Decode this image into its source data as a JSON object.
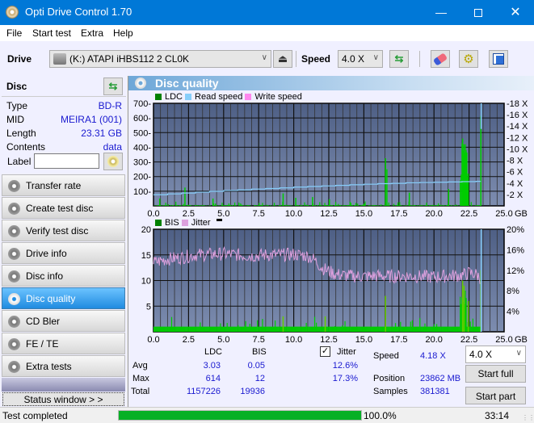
{
  "window": {
    "title": "Opti Drive Control 1.70",
    "minimize_icon": "minimize-icon",
    "maximize_icon": "maximize-icon",
    "close_icon": "close-icon"
  },
  "menu": {
    "items": [
      {
        "label": "File",
        "accel": "F"
      },
      {
        "label": "Start test",
        "accel": "S"
      },
      {
        "label": "Extra",
        "accel": "x"
      },
      {
        "label": "Help",
        "accel": "H"
      }
    ]
  },
  "toolbar": {
    "drive_label": "Drive",
    "drive_value": "(K:)  ATAPI iHBS112  2 CL0K",
    "speed_label": "Speed",
    "speed_value": "4.0 X",
    "icons": [
      "drive-icon",
      "eject-icon",
      "refresh-icon",
      "eraser-icon",
      "settings-icon",
      "save-icon"
    ]
  },
  "disc": {
    "header": "Disc",
    "rows": [
      {
        "key": "Type",
        "value": "BD-R"
      },
      {
        "key": "MID",
        "value": "MEIRA1 (001)"
      },
      {
        "key": "Length",
        "value": "23.31 GB"
      },
      {
        "key": "Contents",
        "value": "data"
      }
    ],
    "label_key": "Label",
    "label_value": ""
  },
  "nav": {
    "items": [
      {
        "label": "Transfer rate",
        "active": false
      },
      {
        "label": "Create test disc",
        "active": false
      },
      {
        "label": "Verify test disc",
        "active": false
      },
      {
        "label": "Drive info",
        "active": false
      },
      {
        "label": "Disc info",
        "active": false
      },
      {
        "label": "Disc quality",
        "active": true
      },
      {
        "label": "CD Bler",
        "active": false
      },
      {
        "label": "FE / TE",
        "active": false
      },
      {
        "label": "Extra tests",
        "active": false
      }
    ],
    "status_window": "Status window > >"
  },
  "panel": {
    "title": "Disc quality"
  },
  "chart_data": [
    {
      "type": "bar",
      "title": "LDC / Read speed",
      "legend": [
        "LDC",
        "Read speed",
        "Write speed"
      ],
      "legend_colors": [
        "#008000",
        "#87cefa",
        "#ff88ee"
      ],
      "legend_placement": "top-left",
      "x_ticks": [
        "0.0",
        "2.5",
        "5.0",
        "7.5",
        "10.0",
        "12.5",
        "15.0",
        "17.5",
        "20.0",
        "22.5",
        "25.0"
      ],
      "x_unit": "GB",
      "xlim": [
        0,
        25
      ],
      "y_ticks": [
        "100",
        "200",
        "300",
        "400",
        "500",
        "600",
        "700"
      ],
      "ylim": [
        0,
        700
      ],
      "y2_ticks": [
        "2 X",
        "4 X",
        "6 X",
        "8 X",
        "10 X",
        "12 X",
        "14 X",
        "16 X",
        "18 X"
      ],
      "y2lim": [
        0,
        18
      ],
      "read_speed": {
        "x": [
          0,
          1,
          2,
          3,
          4,
          5,
          6,
          7,
          8,
          9,
          10,
          11,
          12,
          13,
          14,
          15,
          16,
          17,
          18,
          19,
          20,
          21,
          22,
          23,
          23.31
        ],
        "y": [
          1.95,
          2.1,
          2.25,
          2.4,
          2.55,
          2.7,
          2.8,
          2.95,
          3.05,
          3.15,
          3.3,
          3.4,
          3.5,
          3.6,
          3.7,
          3.8,
          3.9,
          3.95,
          4.05,
          4.1,
          4.15,
          4.2,
          4.25,
          4.3,
          4.35
        ]
      },
      "ldc_peaks": [
        {
          "x": 0.4,
          "y": 50
        },
        {
          "x": 2.2,
          "y": 125
        },
        {
          "x": 4.2,
          "y": 50
        },
        {
          "x": 9.2,
          "y": 85
        },
        {
          "x": 10.1,
          "y": 55
        },
        {
          "x": 11.3,
          "y": 60
        },
        {
          "x": 12.5,
          "y": 45
        },
        {
          "x": 16.5,
          "y": 325
        },
        {
          "x": 16.6,
          "y": 250
        },
        {
          "x": 18.2,
          "y": 90
        },
        {
          "x": 21.0,
          "y": 115
        },
        {
          "x": 22.0,
          "y": 460
        },
        {
          "x": 22.1,
          "y": 420
        },
        {
          "x": 22.4,
          "y": 220
        },
        {
          "x": 23.3,
          "y": 614
        }
      ],
      "grid": true
    },
    {
      "type": "bar",
      "title": "BIS / Jitter",
      "legend": [
        "BIS",
        "Jitter"
      ],
      "legend_colors": [
        "#008000",
        "#dda0dd"
      ],
      "legend_placement": "top-left",
      "x_ticks": [
        "0.0",
        "2.5",
        "5.0",
        "7.5",
        "10.0",
        "12.5",
        "15.0",
        "17.5",
        "20.0",
        "22.5",
        "25.0"
      ],
      "x_unit": "GB",
      "xlim": [
        0,
        25
      ],
      "y_ticks": [
        "5",
        "10",
        "15",
        "20"
      ],
      "ylim": [
        0,
        20
      ],
      "y2_ticks": [
        "4%",
        "8%",
        "12%",
        "16%",
        "20%"
      ],
      "y2lim": [
        0,
        20
      ],
      "jitter": {
        "x": [
          0,
          1,
          2,
          3,
          4,
          5,
          6,
          7,
          8,
          9,
          10,
          11,
          11.5,
          12,
          12.5,
          13,
          14,
          15,
          16,
          17,
          18,
          19,
          20,
          21,
          22,
          22.5,
          23,
          23.31
        ],
        "y": [
          13.5,
          14.2,
          14.5,
          15.0,
          15.1,
          15.2,
          15.0,
          14.8,
          15.0,
          15.0,
          15.1,
          14.8,
          14.0,
          12.5,
          11.8,
          11.2,
          10.9,
          10.8,
          10.9,
          10.8,
          10.9,
          10.8,
          10.7,
          10.9,
          11.0,
          11.5,
          11.2,
          10.5
        ]
      },
      "bis_peaks": [
        {
          "x": 9.2,
          "y": 3
        },
        {
          "x": 12.2,
          "y": 3
        },
        {
          "x": 16.5,
          "y": 7
        },
        {
          "x": 22.0,
          "y": 10
        },
        {
          "x": 22.1,
          "y": 9
        },
        {
          "x": 22.4,
          "y": 6
        },
        {
          "x": 23.3,
          "y": 12
        }
      ],
      "grid": true
    }
  ],
  "stats": {
    "col_ldc": "LDC",
    "col_bis": "BIS",
    "jitter_label": "Jitter",
    "jitter_checked": true,
    "rows": [
      {
        "label": "Avg",
        "ldc": "3.03",
        "bis": "0.05",
        "jitter": "12.6%"
      },
      {
        "label": "Max",
        "ldc": "614",
        "bis": "12",
        "jitter": "17.3%"
      },
      {
        "label": "Total",
        "ldc": "1157226",
        "bis": "19936",
        "jitter": ""
      }
    ],
    "speed_label": "Speed",
    "speed_value": "4.18 X",
    "position_label": "Position",
    "position_value": "23862 MB",
    "samples_label": "Samples",
    "samples_value": "381381",
    "speed_select": "4.0 X",
    "start_full": "Start full",
    "start_part": "Start part"
  },
  "statusbar": {
    "text": "Test completed",
    "progress_percent": 100.0,
    "progress_text": "100.0%",
    "time": "33:14"
  }
}
